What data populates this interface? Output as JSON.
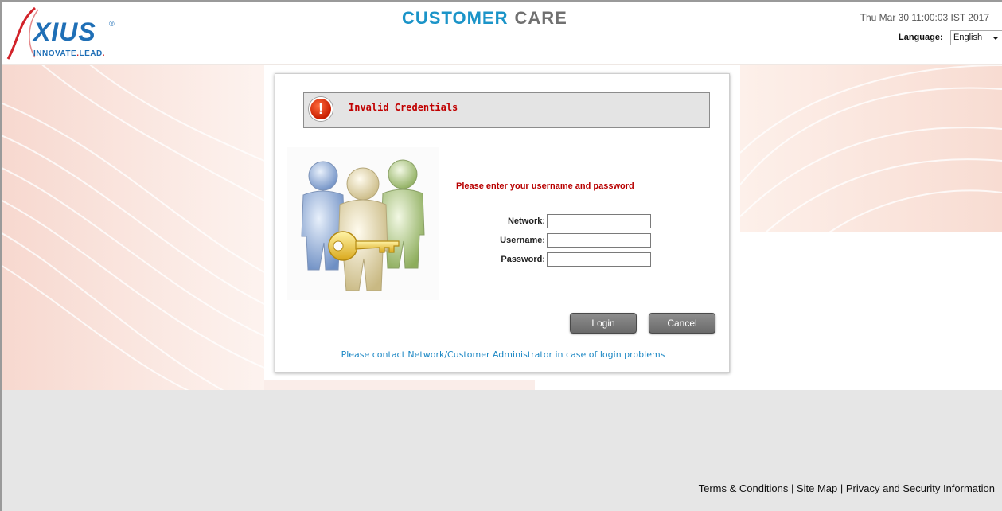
{
  "header": {
    "logo": {
      "brand": "XIUS",
      "registered": "®",
      "tagline_a": "INNOVATE",
      "tagline_b": "LEAD",
      "tagline_sep": "."
    },
    "title_primary": "CUSTOMER",
    "title_secondary": "CARE",
    "datetime": "Thu Mar 30 11:00:03 IST 2017",
    "language_label": "Language:",
    "language_selected": "English"
  },
  "login": {
    "alert_message": "Invalid Credentials",
    "prompt": "Please enter your username and password",
    "network_label": "Network:",
    "username_label": "Username:",
    "password_label": "Password:",
    "network_value": "",
    "username_value": "",
    "password_value": "",
    "login_button": "Login",
    "cancel_button": "Cancel",
    "help_text": "Please contact Network/Customer Administrator in case of login problems"
  },
  "footer": {
    "terms": "Terms & Conditions",
    "sitemap": "Site Map",
    "privacy": "Privacy and Security Information",
    "separator": " | "
  },
  "colors": {
    "brand_blue": "#1f6fb6",
    "title_blue": "#1b94c8",
    "title_gray": "#707070",
    "error_red": "#c00000",
    "link_blue": "#1b87c4"
  },
  "icons": [
    "alert-exclamation-icon",
    "users-key-illustration",
    "chevron-down-icon"
  ]
}
